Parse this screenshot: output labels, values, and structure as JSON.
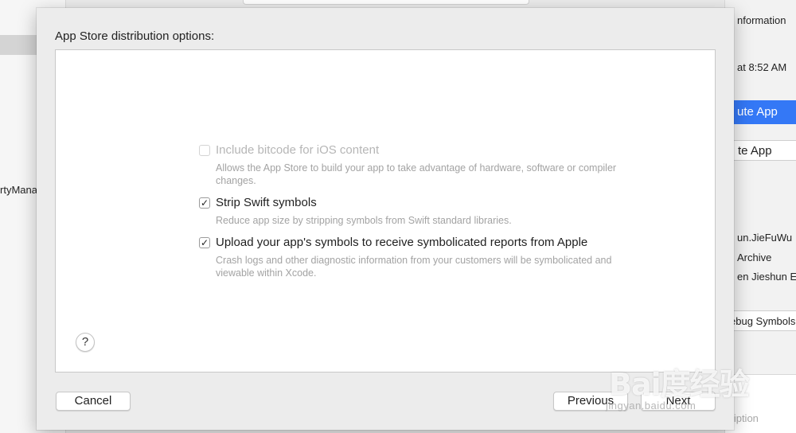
{
  "background": {
    "left_pane_text": "rtyMana",
    "right_pane": {
      "information_label": "nformation",
      "time_label": "at 8:52 AM",
      "distribute_button": "ute App",
      "validate_button": "te App",
      "identifier": "un.JieFuWu",
      "type": "Archive",
      "team": "en Jieshun El",
      "debug_symbols": "ebug Symbols",
      "description_placeholder": "cription"
    }
  },
  "sheet": {
    "title": "App Store distribution options:",
    "options": [
      {
        "label": "Include bitcode for iOS content",
        "description": "Allows the App Store to build your app to take advantage of hardware, software or compiler changes.",
        "checked": false,
        "enabled": false
      },
      {
        "label": "Strip Swift symbols",
        "description": "Reduce app size by stripping symbols from Swift standard libraries.",
        "checked": true,
        "enabled": true
      },
      {
        "label": "Upload your app's symbols to receive symbolicated reports from Apple",
        "description": "Crash logs and other diagnostic information from your customers will be symbolicated and viewable within Xcode.",
        "checked": true,
        "enabled": true
      }
    ],
    "help_label": "?",
    "buttons": {
      "cancel": "Cancel",
      "previous": "Previous",
      "next": "Next"
    }
  },
  "watermark": {
    "brand": "Bai度经验",
    "url": "jingyan.baidu.com"
  },
  "icons": {
    "checkbox_checked_glyph": "✓"
  }
}
